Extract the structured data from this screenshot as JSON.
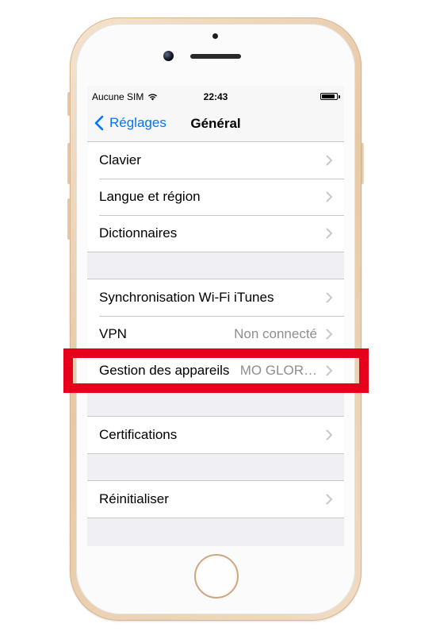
{
  "status_bar": {
    "carrier": "Aucune SIM",
    "time": "22:43",
    "battery_level": 0.9
  },
  "nav": {
    "back_label": "Réglages",
    "title": "Général"
  },
  "groups": [
    {
      "rows": [
        {
          "label": "Clavier",
          "value": ""
        },
        {
          "label": "Langue et région",
          "value": ""
        },
        {
          "label": "Dictionnaires",
          "value": ""
        }
      ]
    },
    {
      "rows": [
        {
          "label": "Synchronisation Wi-Fi iTunes",
          "value": ""
        },
        {
          "label": "VPN",
          "value": "Non connecté"
        },
        {
          "label": "Gestion des appareils",
          "value": "MO GLOR…"
        }
      ]
    },
    {
      "rows": [
        {
          "label": "Certifications",
          "value": ""
        }
      ]
    },
    {
      "rows": [
        {
          "label": "Réinitialiser",
          "value": ""
        }
      ]
    }
  ],
  "colors": {
    "accent": "#0076ff",
    "highlight": "#e6001c",
    "background": "#efeff4",
    "secondary_text": "#8e8e93"
  },
  "icons": {
    "back": "chevron-left-icon",
    "row_disclosure": "chevron-right-icon",
    "wifi": "wifi-icon",
    "battery": "battery-icon"
  }
}
